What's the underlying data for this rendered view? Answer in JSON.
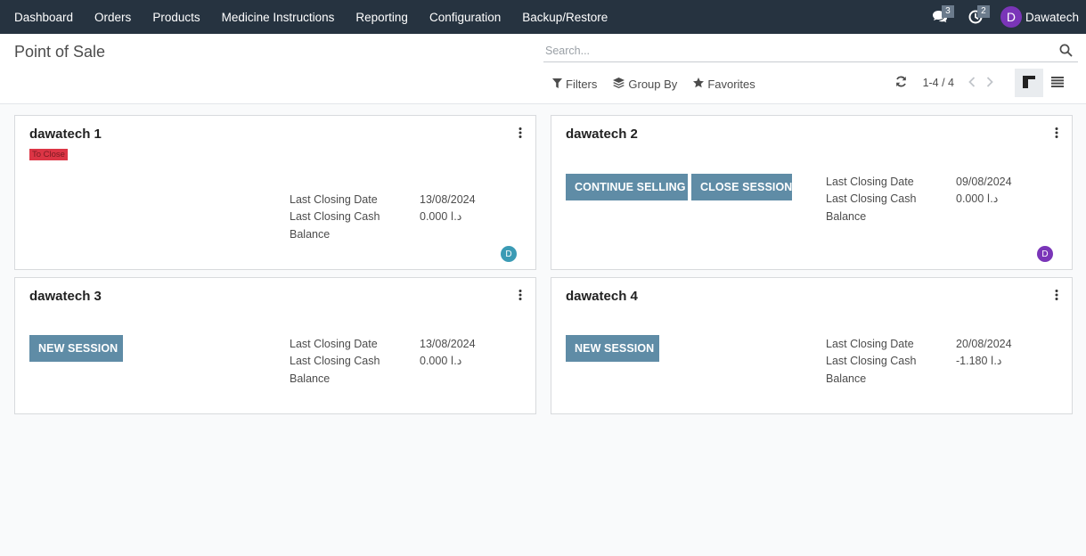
{
  "navbar": {
    "menu": [
      "Dashboard",
      "Orders",
      "Products",
      "Medicine Instructions",
      "Reporting",
      "Configuration",
      "Backup/Restore"
    ],
    "messages_count": "3",
    "activities_count": "2",
    "user_initial": "D",
    "user_name": "Dawatech"
  },
  "control_panel": {
    "title": "Point of Sale",
    "search_placeholder": "Search...",
    "filters_label": "Filters",
    "group_by_label": "Group By",
    "favorites_label": "Favorites",
    "pager": "1-4 / 4"
  },
  "cards": [
    {
      "name": "dawatech 1",
      "status": "To Close",
      "last_closing_date_label": "Last Closing Date",
      "last_closing_date": "13/08/2024",
      "last_closing_cash_label": "Last Closing Cash",
      "balance_label": "Balance",
      "last_closing_cash": "0.000 د.ا",
      "avatar_initial": "D",
      "avatar_color": "#3b9bb5"
    },
    {
      "name": "dawatech 2",
      "continue_label": "CONTINUE SELLING",
      "close_label": "CLOSE SESSION",
      "last_closing_date_label": "Last Closing Date",
      "last_closing_date": "09/08/2024",
      "last_closing_cash_label": "Last Closing Cash",
      "balance_label": "Balance",
      "last_closing_cash": "0.000 د.ا",
      "avatar_initial": "D",
      "avatar_color": "#7a35b8"
    },
    {
      "name": "dawatech 3",
      "new_session_label": "NEW SESSION",
      "last_closing_date_label": "Last Closing Date",
      "last_closing_date": "13/08/2024",
      "last_closing_cash_label": "Last Closing Cash",
      "balance_label": "Balance",
      "last_closing_cash": "0.000 د.ا"
    },
    {
      "name": "dawatech 4",
      "new_session_label": "NEW SESSION",
      "last_closing_date_label": "Last Closing Date",
      "last_closing_date": "20/08/2024",
      "last_closing_cash_label": "Last Closing Cash",
      "balance_label": "Balance",
      "last_closing_cash": "-1.180 د.ا"
    }
  ],
  "colors": {
    "navbar": "#263340",
    "button": "#5f8ca6",
    "status_badge": "#dc3545"
  },
  "icons": [
    "chat-icon",
    "clock-icon",
    "search-icon",
    "filter-icon",
    "layers-icon",
    "star-icon",
    "refresh-icon",
    "chevron-left-icon",
    "chevron-right-icon",
    "kanban-view-icon",
    "list-view-icon",
    "kebab-menu-icon"
  ]
}
